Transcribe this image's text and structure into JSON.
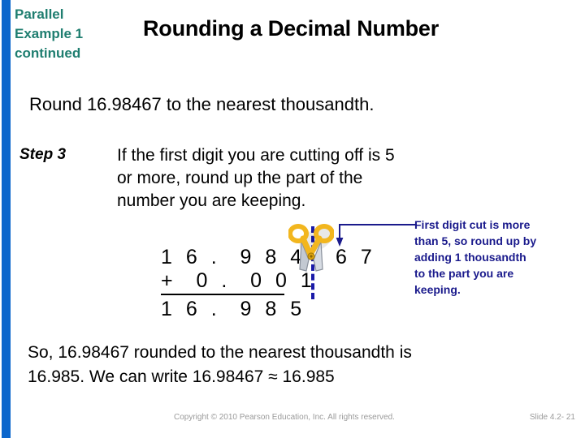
{
  "colors": {
    "accent_bar": "#0B66CC",
    "header_label": "#1F7E70",
    "callout_text": "#1A1A8C",
    "cut_line": "#1A1AA8",
    "scissors_handle": "#F2B61E",
    "scissors_blade": "#A8AFBA",
    "footer": "#9A9A9A"
  },
  "header": {
    "label_line1": "Parallel",
    "label_line2": "Example 1",
    "label_line3": "continued",
    "title": "Rounding a Decimal Number"
  },
  "problem": {
    "statement": "Round 16.98467 to the nearest thousandth."
  },
  "step": {
    "label": "Step 3",
    "body_line1": "If the first digit you are cutting off is 5",
    "body_line2": "or more, round up the part of the",
    "body_line3": "number you are keeping."
  },
  "math": {
    "kept_part": "1 6 .  9 8 4",
    "cut_part": "6 7",
    "addend": "+  0 .  0 0 1",
    "sum": "1 6 .  9 8 5"
  },
  "callout": {
    "line1": "First digit cut is more",
    "line2": "than 5, so round up by",
    "line3": "adding 1 thousandth",
    "line4": "to the part you are",
    "line5": "keeping."
  },
  "conclusion": {
    "line1": "So, 16.98467 rounded to the nearest thousandth is",
    "line2": "16.985. We can write 16.98467 ≈ 16.985"
  },
  "footer": {
    "copyright": "Copyright © 2010 Pearson Education, Inc.  All rights reserved.",
    "slide_number": "Slide 4.2- 21"
  }
}
